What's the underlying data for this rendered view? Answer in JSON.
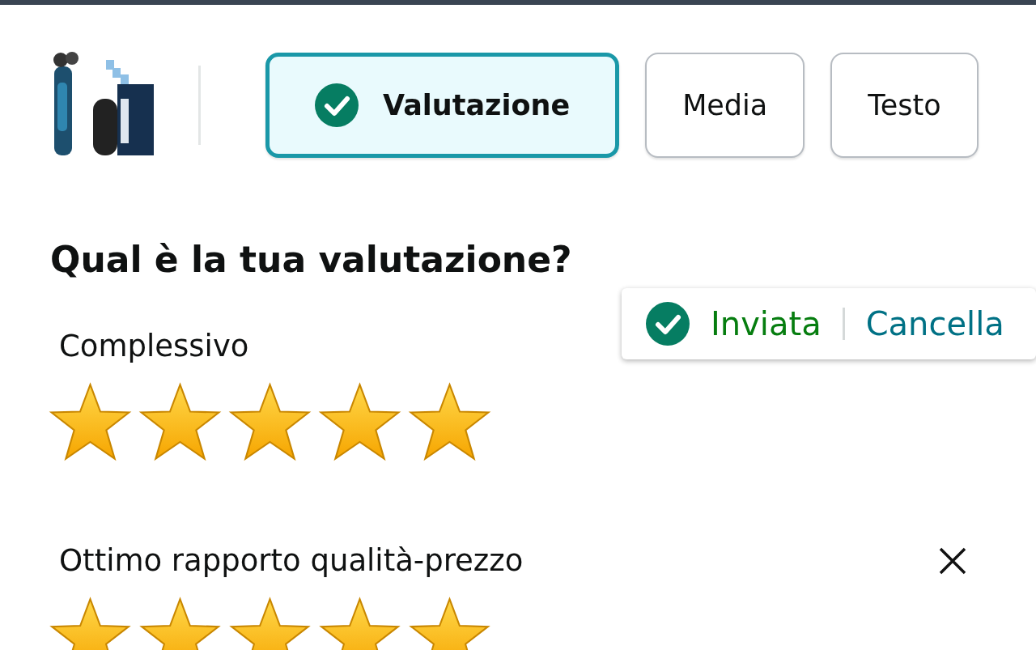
{
  "tabs": [
    {
      "label": "Valutazione",
      "selected": true,
      "completed": true
    },
    {
      "label": "Media",
      "selected": false,
      "completed": false
    },
    {
      "label": "Testo",
      "selected": false,
      "completed": false
    }
  ],
  "heading": "Qual è la tua valutazione?",
  "status": {
    "label": "Inviata",
    "action": "Cancella"
  },
  "ratings": [
    {
      "label": "Complessivo",
      "stars": 5,
      "removable": false
    },
    {
      "label": "Ottimo rapporto qualità-prezzo",
      "stars": 5,
      "removable": true
    }
  ]
}
